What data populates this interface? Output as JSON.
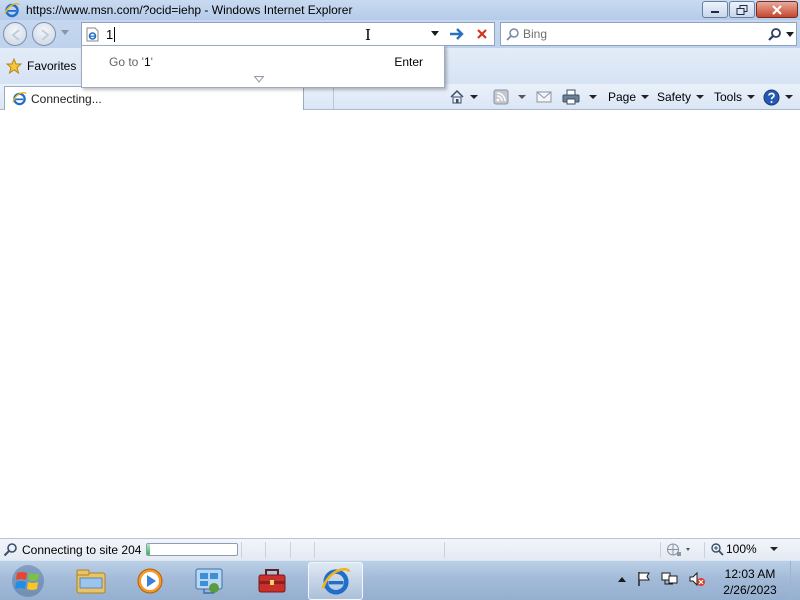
{
  "window": {
    "title": "https://www.msn.com/?ocid=iehp - Windows Internet Explorer",
    "controls": [
      "minimize",
      "maximize",
      "close"
    ]
  },
  "address_bar": {
    "value": "1",
    "icons": [
      "ie-page-icon",
      "dropdown-arrow-icon",
      "go-arrow-icon",
      "stop-x-icon"
    ]
  },
  "search": {
    "placeholder": "Bing"
  },
  "autocomplete": {
    "goto_prefix": "Go to '",
    "goto_value": "1",
    "goto_suffix": "'",
    "enter_label": "Enter"
  },
  "favorites": {
    "label": "Favorites"
  },
  "tab": {
    "label": "Connecting..."
  },
  "command_bar": {
    "page_label": "Page",
    "safety_label": "Safety",
    "tools_label": "Tools"
  },
  "status": {
    "text": "Connecting to site 204",
    "progress_fraction": 0.03,
    "zoom": "100%"
  },
  "taskbar": {
    "pinned": [
      "start-orb",
      "file-explorer",
      "media-player",
      "server-manager",
      "toolbox",
      "internet-explorer"
    ],
    "active": "internet-explorer"
  },
  "clock": {
    "time": "12:03 AM",
    "date": "2/26/2023"
  },
  "colors": {
    "title_bar": "#c9daf0",
    "close_button": "#c4482e",
    "progress_fill": "#2fb54c",
    "ie_blue": "#1f6fc9"
  }
}
